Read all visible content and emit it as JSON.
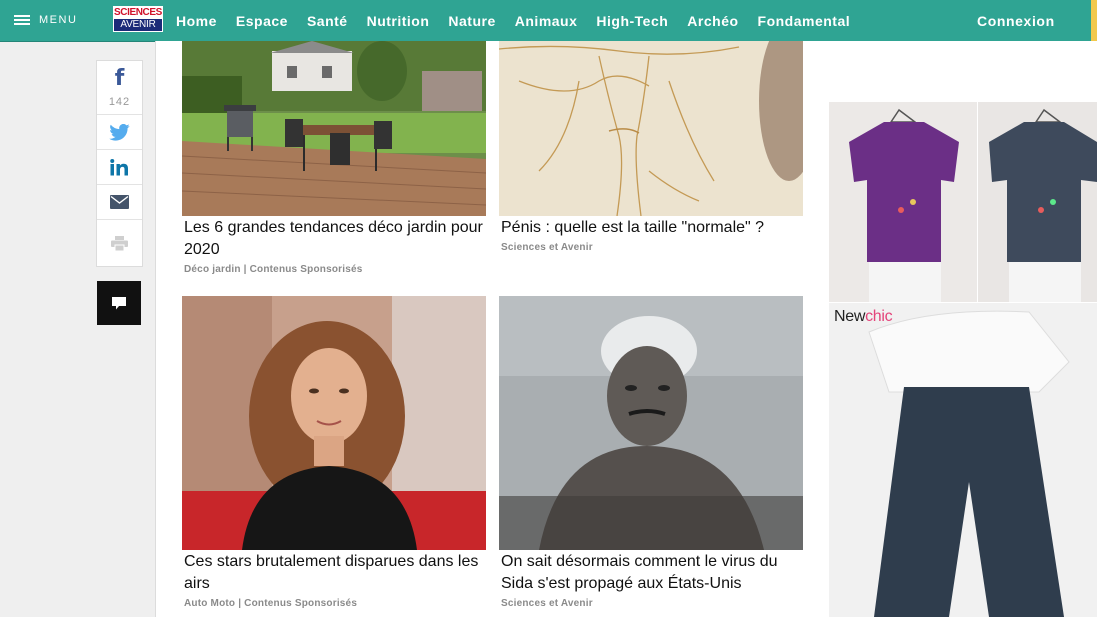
{
  "header": {
    "menu_label": "MENU",
    "logo_line1": "SCIENCES",
    "logo_line2": "AVENIR",
    "nav": [
      "Home",
      "Espace",
      "Santé",
      "Nutrition",
      "Nature",
      "Animaux",
      "High-Tech",
      "Archéo",
      "Fondamental"
    ],
    "login_label": "Connexion",
    "colors": {
      "bar": "#2fa493",
      "accent": "#f2c94c"
    }
  },
  "share": {
    "facebook_count": "142",
    "icons": [
      "facebook-icon",
      "twitter-icon",
      "linkedin-icon",
      "mail-icon",
      "print-icon",
      "comment-icon"
    ]
  },
  "articles": [
    {
      "title": "Les 6 grandes tendances déco jardin pour 2020",
      "source": "Déco jardin | Contenus Sponsorisés"
    },
    {
      "title": "Pénis : quelle est la taille \"normale\" ?",
      "source": "Sciences et Avenir"
    },
    {
      "title": "Ces stars brutalement disparues dans les airs",
      "source": "Auto Moto | Contenus Sponsorisés"
    },
    {
      "title": "On sait désormais comment le virus du Sida s'est propagé aux États-Unis",
      "source": "Sciences et Avenir"
    }
  ],
  "ad": {
    "brand_part1": "New",
    "brand_part2": "chic"
  }
}
